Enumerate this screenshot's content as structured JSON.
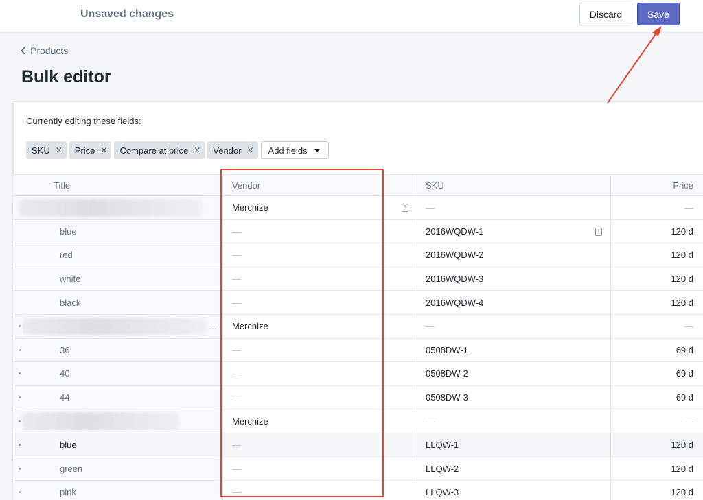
{
  "topbar": {
    "status": "Unsaved changes",
    "discard_label": "Discard",
    "save_label": "Save"
  },
  "breadcrumb": {
    "label": "Products"
  },
  "page": {
    "title": "Bulk editor"
  },
  "editing": {
    "label": "Currently editing these fields:",
    "fields": [
      {
        "label": "SKU"
      },
      {
        "label": "Price"
      },
      {
        "label": "Compare at price"
      },
      {
        "label": "Vendor"
      }
    ],
    "add_fields_label": "Add fields"
  },
  "table": {
    "headers": {
      "title": "Title",
      "vendor": "Vendor",
      "sku": "SKU",
      "price": "Price"
    },
    "rows": [
      {
        "type": "product",
        "title": "",
        "vendor": "Merchize",
        "sku": "—",
        "price": "—"
      },
      {
        "type": "variant",
        "title": "blue",
        "vendor": "—",
        "sku": "2016WQDW-1",
        "price": "120 đ"
      },
      {
        "type": "variant",
        "title": "red",
        "vendor": "—",
        "sku": "2016WQDW-2",
        "price": "120 đ"
      },
      {
        "type": "variant",
        "title": "white",
        "vendor": "—",
        "sku": "2016WQDW-3",
        "price": "120 đ"
      },
      {
        "type": "variant",
        "title": "black",
        "vendor": "—",
        "sku": "2016WQDW-4",
        "price": "120 đ"
      },
      {
        "type": "product",
        "title": "",
        "vendor": "Merchize",
        "sku": "—",
        "price": "—"
      },
      {
        "type": "variant",
        "title": "36",
        "vendor": "—",
        "sku": "0508DW-1",
        "price": "69 đ"
      },
      {
        "type": "variant",
        "title": "40",
        "vendor": "—",
        "sku": "0508DW-2",
        "price": "69 đ"
      },
      {
        "type": "variant",
        "title": "44",
        "vendor": "—",
        "sku": "0508DW-3",
        "price": "69 đ"
      },
      {
        "type": "product",
        "title": "",
        "vendor": "Merchize",
        "sku": "—",
        "price": "—"
      },
      {
        "type": "variant",
        "title": "blue",
        "vendor": "—",
        "sku": "LLQW-1",
        "price": "120 đ"
      },
      {
        "type": "variant",
        "title": "green",
        "vendor": "—",
        "sku": "LLQW-2",
        "price": "120 đ"
      },
      {
        "type": "variant",
        "title": "pink",
        "vendor": "—",
        "sku": "LLQW-3",
        "price": "120 đ"
      }
    ],
    "ellipsis": "…"
  },
  "colors": {
    "accent": "#5c6ac4",
    "annotation": "#e4472f"
  },
  "icons": [
    "chevron-left-icon",
    "close-icon",
    "caret-down-icon",
    "warning-icon"
  ]
}
